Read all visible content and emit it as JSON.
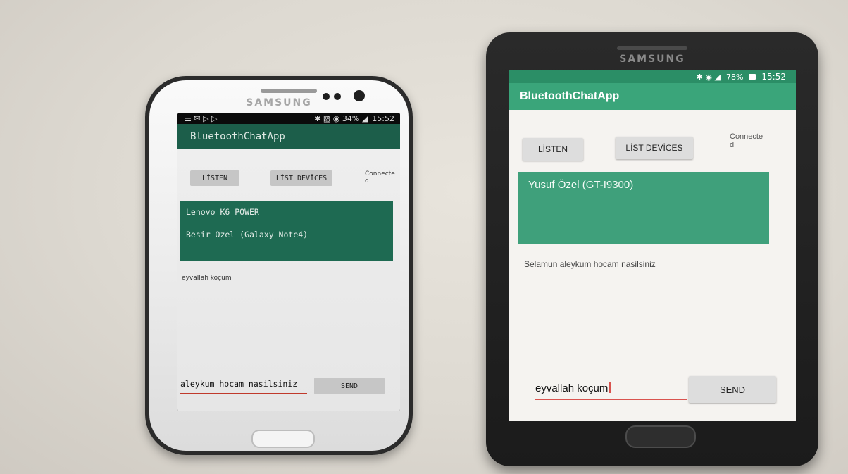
{
  "left_phone": {
    "brand": "SAMSUNG",
    "status": {
      "icons": "☰ ✉ ▷ ▷",
      "right": "✱ ▧ ◉ 34% ◢",
      "time": "15:52"
    },
    "app_title": "BluetoothChatApp",
    "listen_label": "LİSTEN",
    "list_devices_label": "LİST DEVİCES",
    "connected_label": "Connecte",
    "connected_label_2": "d",
    "devices": [
      "Lenovo K6 POWER",
      "Besir Ozel (Galaxy Note4)"
    ],
    "received_message": "eyvallah koçum",
    "input_value": "aleykum hocam nasilsiniz",
    "send_label": "SEND"
  },
  "right_phone": {
    "brand": "SAMSUNG",
    "status": {
      "icons": "✱ ◉ ◢",
      "battery": "78%",
      "time": "15:52"
    },
    "app_title": "BluetoothChatApp",
    "listen_label": "LİSTEN",
    "list_devices_label": "LİST DEVİCES",
    "connected_label": "Connecte",
    "connected_label_2": "d",
    "devices": [
      "Yusuf Özel (GT-I9300)"
    ],
    "received_message": "Selamun aleykum hocam nasilsiniz",
    "input_value": "eyvallah koçum",
    "send_label": "SEND"
  },
  "colors": {
    "left_appbar": "#1c5e4a",
    "left_list": "#1e6a52",
    "right_statusbar": "#2b8e66",
    "right_appbar": "#3aa57a",
    "right_list": "#3fa07b",
    "input_underline": "#d9534f"
  }
}
